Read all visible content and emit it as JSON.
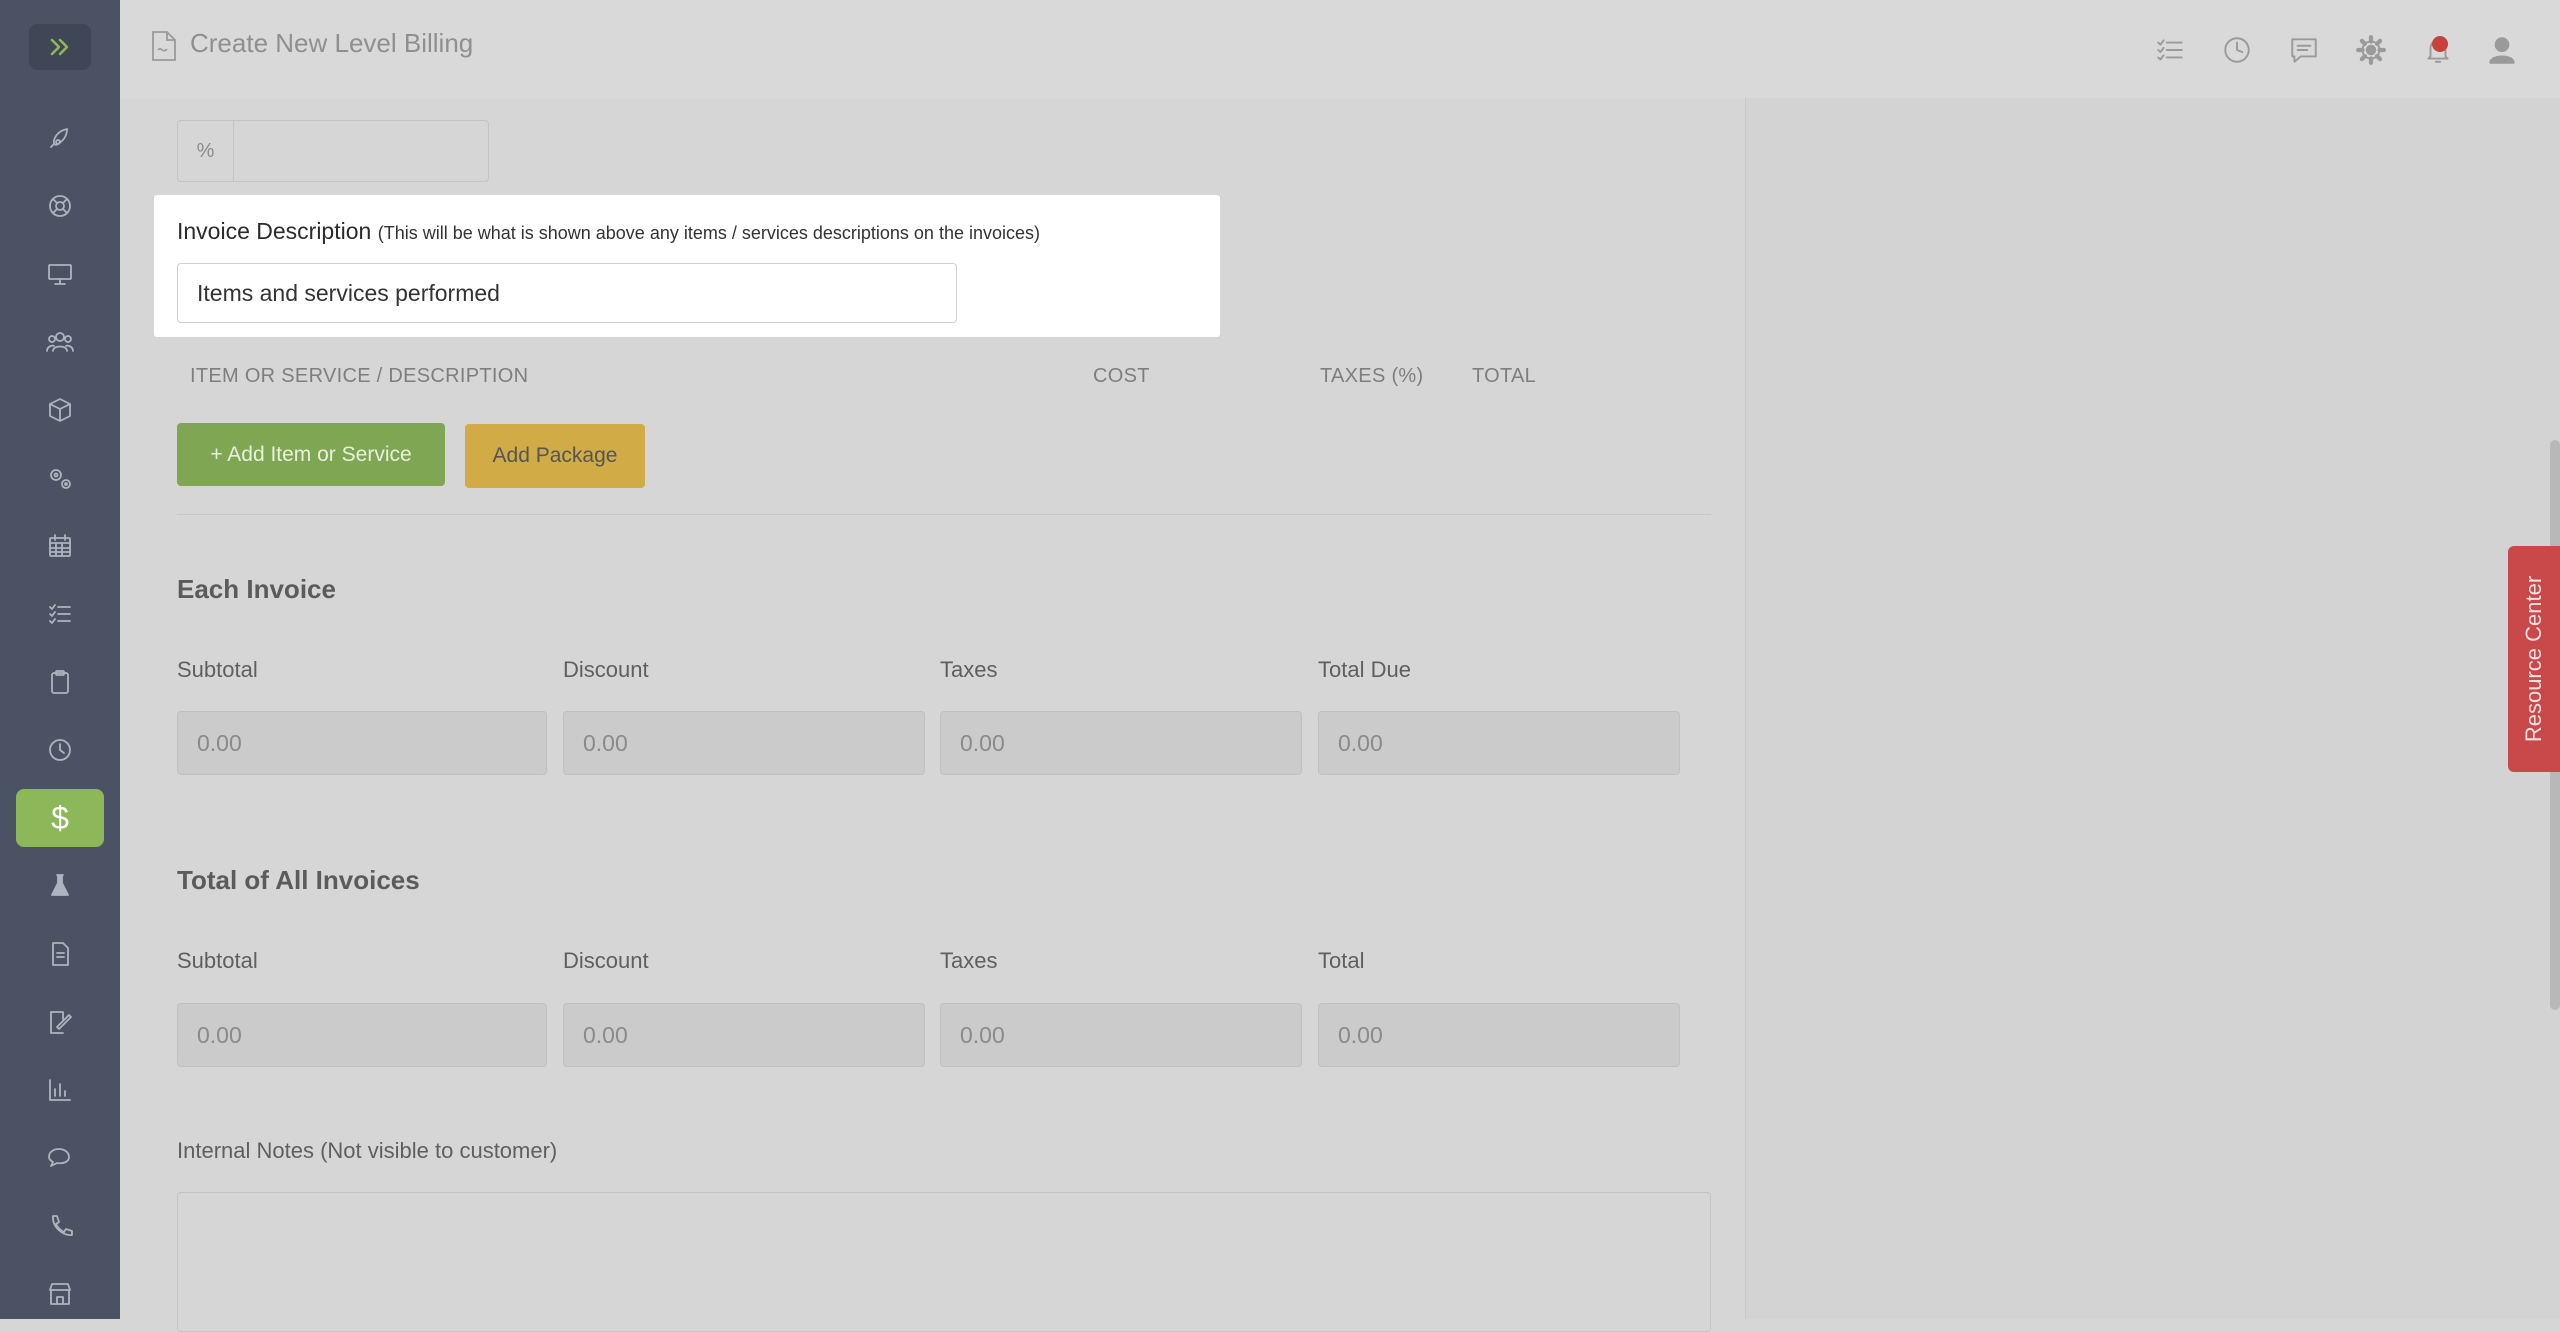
{
  "header": {
    "title": "Create New Level Billing",
    "icons": [
      "checklist-icon",
      "clock-icon",
      "chat-icon",
      "gear-icon",
      "bell-icon",
      "user-icon"
    ]
  },
  "sidebar": {
    "items": [
      "rocket-icon",
      "lifebuoy-icon",
      "monitor-icon",
      "users-icon",
      "box-icon",
      "gears-icon",
      "calendar-icon",
      "checklist-icon",
      "clipboard-icon",
      "clock-icon",
      "dollar-icon",
      "flask-icon",
      "document-icon",
      "signature-icon",
      "chart-icon",
      "chat-icon",
      "phone-icon",
      "store-icon"
    ],
    "active": "dollar-icon",
    "active_symbol": "$"
  },
  "form": {
    "percent_symbol": "%",
    "invoice_description_label": "Invoice Description",
    "invoice_description_hint": "(This will be what is shown above any items / services descriptions on the invoices)",
    "invoice_description_value": "Items and services performed",
    "columns": [
      "ITEM OR SERVICE / DESCRIPTION",
      "COST",
      "TAXES (%)",
      "TOTAL"
    ],
    "add_item_label": "+ Add Item or Service",
    "add_package_label": "Add Package",
    "each_invoice": {
      "title": "Each Invoice",
      "labels": [
        "Subtotal",
        "Discount",
        "Taxes",
        "Total Due"
      ],
      "values": [
        "0.00",
        "0.00",
        "0.00",
        "0.00"
      ]
    },
    "all_invoices": {
      "title": "Total of All Invoices",
      "labels": [
        "Subtotal",
        "Discount",
        "Taxes",
        "Total"
      ],
      "values": [
        "0.00",
        "0.00",
        "0.00",
        "0.00"
      ]
    },
    "notes_label": "Internal Notes (Not visible to customer)",
    "notes_value": ""
  },
  "resource_center": {
    "label": "Resource Center"
  },
  "colors": {
    "accent_green": "#8db85a",
    "package_yellow": "#d0ab46",
    "resource_red": "#c9484a",
    "sidebar_bg": "#4a5263"
  }
}
